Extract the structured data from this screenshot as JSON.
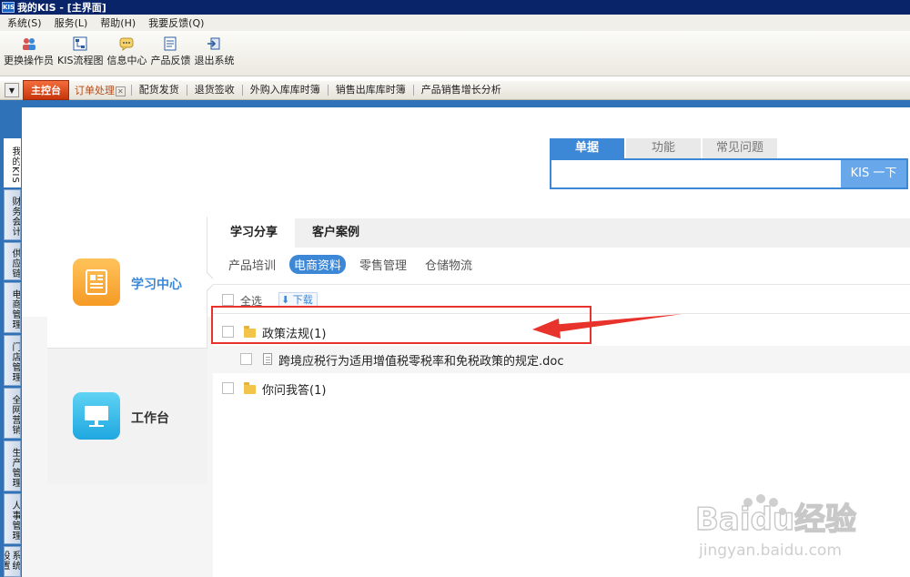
{
  "window": {
    "app_icon_text": "KIS",
    "title": "我的KIS - [主界面]"
  },
  "menu": [
    {
      "label": "系统(S)"
    },
    {
      "label": "服务(L)"
    },
    {
      "label": "帮助(H)"
    },
    {
      "label": "我要反馈(Q)"
    }
  ],
  "toolbar": [
    {
      "label": "更换操作员",
      "icon": "users-icon"
    },
    {
      "label": "KIS流程图",
      "icon": "flowchart-icon"
    },
    {
      "label": "信息中心",
      "icon": "chat-icon"
    },
    {
      "label": "产品反馈",
      "icon": "feedback-icon"
    },
    {
      "label": "退出系统",
      "icon": "exit-icon"
    }
  ],
  "tabs": {
    "home": "主控台",
    "order": "订单处理",
    "others": [
      "配货发货",
      "退货签收",
      "外购入库库时簿",
      "销售出库库时簿",
      "产品销售增长分析"
    ]
  },
  "left_tabs": [
    "我的KIS",
    "财务会计",
    "供应链",
    "电商管理",
    "门店管理",
    "全网营销",
    "生产管理",
    "人事管理",
    "系统设置"
  ],
  "search": {
    "tabs": [
      "单据",
      "功能",
      "常见问题"
    ],
    "active_tab": "单据",
    "input_value": "",
    "button": "KIS 一下"
  },
  "left_panel": {
    "items": [
      {
        "label": "学习中心",
        "icon": "document-icon",
        "active": true
      },
      {
        "label": "工作台",
        "icon": "monitor-icon",
        "active": false
      }
    ]
  },
  "content": {
    "tabs": [
      "学习分享",
      "客户案例"
    ],
    "categories": [
      "产品培训",
      "电商资料",
      "零售管理",
      "仓储物流"
    ],
    "active_category": "电商资料",
    "select_all": "全选",
    "download": "下载",
    "rows": [
      {
        "type": "folder",
        "label": "政策法规(1)"
      },
      {
        "type": "file",
        "label": "跨境应税行为适用增值税零税率和免税政策的规定.doc"
      },
      {
        "type": "folder",
        "label": "你问我答(1)"
      }
    ]
  },
  "watermark": {
    "brand": "Baidu经验",
    "url": "jingyan.baidu.com"
  },
  "colors": {
    "title_bar": "#0a246a",
    "accent_blue": "#3c87d6",
    "home_tab": "#e0541f",
    "highlight_red": "#e8322c"
  }
}
